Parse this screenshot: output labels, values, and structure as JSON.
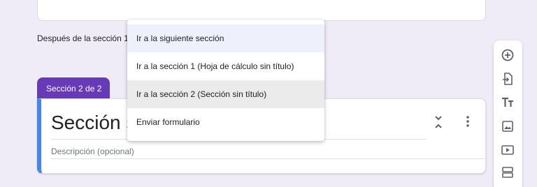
{
  "routing": {
    "after_section_label": "Después de la sección 1",
    "options": [
      "Ir a la siguiente sección",
      "Ir a la sección 1 (Hoja de cálculo sin título)",
      "Ir a la sección 2 (Sección sin título)",
      "Enviar formulario"
    ]
  },
  "section": {
    "tab_label": "Sección 2 de 2",
    "title": "Sección sin título",
    "description_placeholder": "Descripción (opcional)"
  },
  "toolbar": {
    "icons": [
      "add-circle-icon",
      "import-questions-icon",
      "add-title-icon",
      "add-image-icon",
      "add-video-icon",
      "add-section-icon"
    ]
  },
  "colors": {
    "background": "#efebf7",
    "accent_purple": "#673ab7",
    "section_accent_blue": "#4285f4"
  }
}
